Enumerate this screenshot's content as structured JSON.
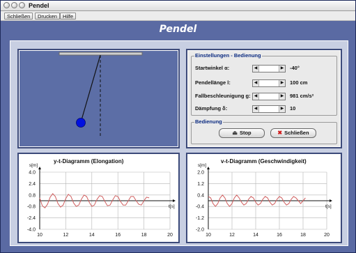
{
  "window": {
    "title": "Pendel"
  },
  "menu": [
    {
      "label": "Schließen"
    },
    {
      "label": "Drucken"
    },
    {
      "label": "Hilfe"
    }
  ],
  "app_title": "Pendel",
  "settings": {
    "group_title": "Einstellungen - Bedienung",
    "rows": [
      {
        "label": "Startwinkel α:",
        "value": "-40°"
      },
      {
        "label": "Pendellänge l:",
        "value": "100 cm"
      },
      {
        "label": "Fallbeschleunigung g:",
        "value": "981 cm/s²"
      },
      {
        "label": "Dämpfung δ:",
        "value": "10"
      }
    ]
  },
  "control": {
    "group_title": "Bedienung",
    "stop_label": "Stop",
    "close_label": "Schließen"
  },
  "colors": {
    "curve": "#d06060",
    "bob": "#0010e0",
    "window": "#5a6aa3"
  },
  "chart_data": [
    {
      "type": "line",
      "title": "y-t-Diagramm (Elongation)",
      "ylabel": "s[m]",
      "xlabel": "t[s]",
      "yticks": [
        "4.0",
        "2.4",
        "0.8",
        "-0.8",
        "-2.4",
        "-4.0"
      ],
      "xticks": [
        "10",
        "12",
        "14",
        "16",
        "18",
        "20"
      ],
      "xlim": [
        10,
        20
      ],
      "ylim": [
        -4.0,
        4.0
      ],
      "series": [
        {
          "x": [
            10.0,
            10.2,
            10.4,
            10.6,
            10.8,
            11.0,
            11.2,
            11.4,
            11.6,
            11.8,
            12.0,
            12.2,
            12.4,
            12.6,
            12.8,
            13.0,
            13.2,
            13.4,
            13.6,
            13.8,
            14.0,
            14.2,
            14.4,
            14.6,
            14.8,
            15.0,
            15.2,
            15.4,
            15.6,
            15.8,
            16.0,
            16.2,
            16.4,
            16.6,
            16.8,
            17.0,
            17.2,
            17.4,
            17.6,
            17.8,
            18.0,
            18.2,
            18.4
          ],
          "y": [
            0.4,
            -0.7,
            -1.0,
            -0.5,
            0.5,
            1.0,
            0.6,
            -0.4,
            -0.9,
            -0.6,
            0.3,
            0.9,
            0.6,
            -0.3,
            -0.8,
            -0.6,
            0.2,
            0.8,
            0.6,
            -0.2,
            -0.8,
            -0.6,
            0.2,
            0.7,
            0.6,
            -0.1,
            -0.7,
            -0.6,
            0.1,
            0.7,
            0.6,
            -0.1,
            -0.6,
            -0.6,
            0.0,
            0.6,
            0.6,
            0.0,
            -0.5,
            -0.6,
            0.0,
            0.5,
            0.4
          ]
        }
      ]
    },
    {
      "type": "line",
      "title": "v-t-Diagramm (Geschwindigkeit)",
      "ylabel": "s[m]",
      "xlabel": "t[s]",
      "yticks": [
        "2.0",
        "1.2",
        "0.4",
        "-0.4",
        "-1.2",
        "-2.0"
      ],
      "xticks": [
        "10",
        "12",
        "14",
        "16",
        "18",
        "20"
      ],
      "xlim": [
        10,
        20
      ],
      "ylim": [
        -2.0,
        2.0
      ],
      "series": [
        {
          "x": [
            10.0,
            10.2,
            10.4,
            10.6,
            10.8,
            11.0,
            11.2,
            11.4,
            11.6,
            11.8,
            12.0,
            12.2,
            12.4,
            12.6,
            12.8,
            13.0,
            13.2,
            13.4,
            13.6,
            13.8,
            14.0,
            14.2,
            14.4,
            14.6,
            14.8,
            15.0,
            15.2,
            15.4,
            15.6,
            15.8,
            16.0,
            16.2,
            16.4,
            16.6,
            16.8,
            17.0,
            17.2,
            17.4,
            17.6,
            17.8,
            18.0,
            18.2
          ],
          "y": [
            0.3,
            0.2,
            -0.2,
            -0.4,
            -0.2,
            0.2,
            0.4,
            0.2,
            -0.2,
            -0.4,
            -0.2,
            0.2,
            0.4,
            0.2,
            -0.1,
            -0.3,
            -0.2,
            0.1,
            0.3,
            0.2,
            -0.1,
            -0.3,
            -0.2,
            0.1,
            0.3,
            0.2,
            -0.1,
            -0.3,
            -0.2,
            0.1,
            0.3,
            0.2,
            -0.1,
            -0.3,
            -0.2,
            0.1,
            0.3,
            0.2,
            0.0,
            -0.2,
            0.0,
            0.2
          ]
        }
      ]
    }
  ]
}
